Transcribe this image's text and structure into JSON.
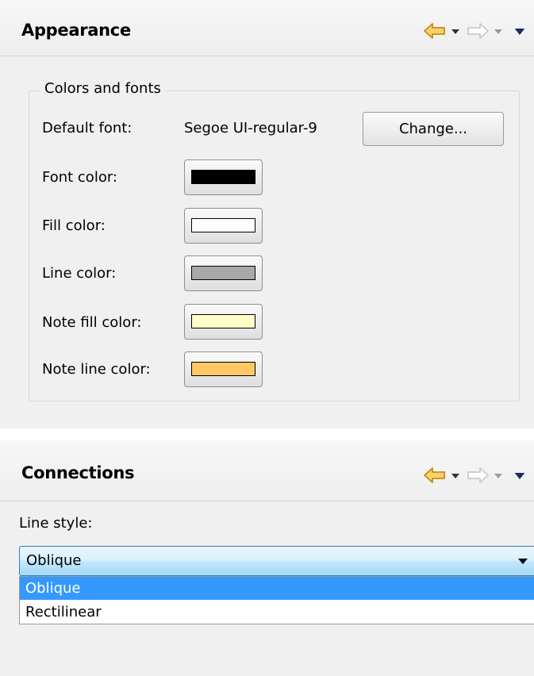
{
  "appearance": {
    "title": "Appearance",
    "group_label": "Colors and fonts",
    "default_font_label": "Default font:",
    "default_font_value": "Segoe UI-regular-9",
    "change_button_label": "Change...",
    "colors": [
      {
        "label": "Font color:",
        "color": "#000000"
      },
      {
        "label": "Fill color:",
        "color": "#ffffff"
      },
      {
        "label": "Line color:",
        "color": "#a9a9a9"
      },
      {
        "label": "Note fill color:",
        "color": "#ffffc8"
      },
      {
        "label": "Note line color:",
        "color": "#ffc864"
      }
    ]
  },
  "connections": {
    "title": "Connections",
    "line_style_label": "Line style:",
    "line_style_selected": "Oblique",
    "line_style_options": [
      "Oblique",
      "Rectilinear"
    ]
  },
  "nav_icons": {
    "back": "back-arrow-icon",
    "back_menu": "chevron-down-icon",
    "forward": "forward-arrow-icon",
    "forward_menu": "chevron-down-icon",
    "view_menu": "view-menu-icon"
  },
  "theme": {
    "back_arrow_fill": "#f8d36a",
    "back_arrow_stroke": "#c68b15",
    "forward_arrow_stroke": "#c9c9c9",
    "view_menu_color": "#1d2a63",
    "selection_color": "#3399ff"
  }
}
